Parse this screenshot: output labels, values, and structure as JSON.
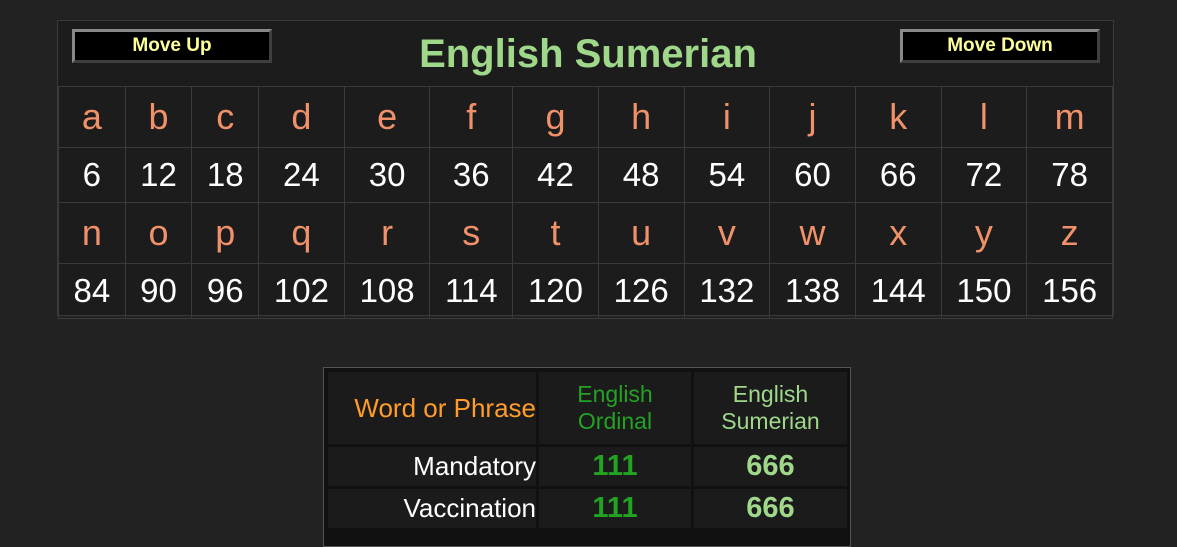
{
  "cipher": {
    "title": "English Sumerian",
    "move_up_label": "Move Up",
    "move_down_label": "Move Down",
    "row1_letters": [
      "a",
      "b",
      "c",
      "d",
      "e",
      "f",
      "g",
      "h",
      "i",
      "j",
      "k",
      "l",
      "m"
    ],
    "row1_values": [
      "6",
      "12",
      "18",
      "24",
      "30",
      "36",
      "42",
      "48",
      "54",
      "60",
      "66",
      "72",
      "78"
    ],
    "row2_letters": [
      "n",
      "o",
      "p",
      "q",
      "r",
      "s",
      "t",
      "u",
      "v",
      "w",
      "x",
      "y",
      "z"
    ],
    "row2_values": [
      "84",
      "90",
      "96",
      "102",
      "108",
      "114",
      "120",
      "126",
      "132",
      "138",
      "144",
      "150",
      "156"
    ]
  },
  "results": {
    "headers": {
      "phrase": "Word or Phrase",
      "ordinal_line1": "English",
      "ordinal_line2": "Ordinal",
      "sumerian_line1": "English",
      "sumerian_line2": "Sumerian"
    },
    "rows": [
      {
        "phrase": "Mandatory",
        "ordinal": "111",
        "sumerian": "666"
      },
      {
        "phrase": "Vaccination",
        "ordinal": "111",
        "sumerian": "666"
      }
    ]
  },
  "colors": {
    "background": "#222222",
    "title": "#9fd88a",
    "letters": "#f0916a",
    "button_text": "#ffff99",
    "phrase_header": "#ff9c2a",
    "ordinal": "#22a322",
    "sumerian": "#9fd88a"
  }
}
